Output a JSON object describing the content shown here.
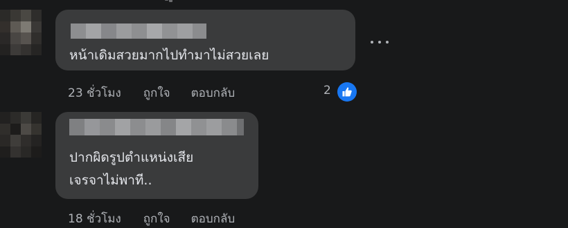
{
  "comments": [
    {
      "text": "หน้าเดิมสวยมากไปทำมาไม่สวยเลย",
      "time": "23 ชั่วโมง",
      "like_label": "ถูกใจ",
      "reply_label": "ตอบกลับ",
      "reaction_count": "2",
      "reaction_icon": "like-icon"
    },
    {
      "text": "ปากผิดรูปตำแหน่งเสีย\nเจรจาไม่พาที..",
      "time": "18 ชั่วโมง",
      "like_label": "ถูกใจ",
      "reply_label": "ตอบกลับ"
    }
  ],
  "more_menu_icon": "more-horizontal-icon",
  "colors": {
    "background": "#18191a",
    "bubble": "#3a3b3c",
    "text": "#e4e6eb",
    "secondary_text": "#b0b3b8",
    "like_blue": "#1877f2"
  }
}
